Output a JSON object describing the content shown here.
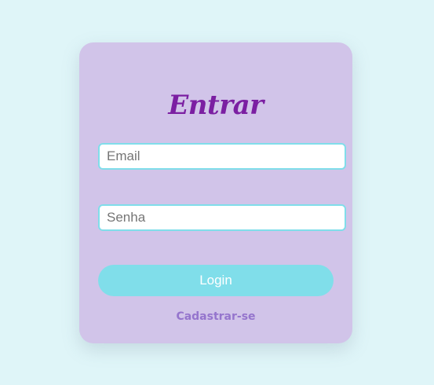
{
  "login_card": {
    "title": "Entrar",
    "email_placeholder": "Email",
    "password_placeholder": "Senha",
    "login_label": "Login",
    "signup_label": "Cadastrar-se"
  },
  "colors": {
    "background": "#dff5f8",
    "card": "#d1c4e9",
    "title": "#7b1fa2",
    "accent": "#80deea",
    "link": "#9575cd"
  }
}
